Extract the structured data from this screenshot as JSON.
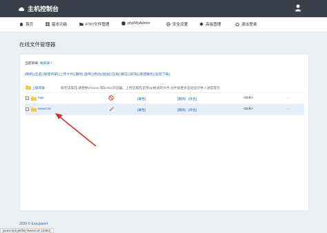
{
  "header": {
    "title": "主机控制台",
    "logo_icon": "cloud-icon",
    "user_icon": "user-icon"
  },
  "nav": [
    {
      "label": "首页",
      "icon": "home-icon"
    },
    {
      "label": "基本功能",
      "icon": "grid-icon"
    },
    {
      "label": "FTP/文件管理",
      "icon": "folder-icon"
    },
    {
      "label": "phpMyAdmin",
      "icon": "database-icon"
    },
    {
      "label": "安全设置",
      "icon": "gear-icon"
    },
    {
      "label": "高级管理",
      "icon": "diamond-icon"
    },
    {
      "label": "退出登录",
      "icon": "power-icon"
    }
  ],
  "page_title": "在线文件管理器",
  "current_dir": {
    "label": "当前目录:",
    "path": "根目录",
    "sep": "/"
  },
  "toolbar": [
    "[刷新]",
    "[全选]",
    "[新建目录]",
    "[上传文件]",
    "[删除]",
    "[复制]",
    "[移动]",
    "[粘贴]",
    "[压缩]",
    "[解压]",
    "[权限]",
    "[重建属性]",
    "[远程下载]"
  ],
  "parent_row": {
    "label": "上级目录",
    "tip": "如无法操作,请更换chrome,或firefox浏览器。上传压缩包支持zip格式的文件,文件能更多自动显示导入进度提示"
  },
  "files": [
    {
      "name": "logs",
      "prop": "[属性]",
      "delete": "[删除]",
      "rename": "[改名]",
      "type": "<DIR>",
      "size": "-",
      "status_icon": "forbidden-icon"
    },
    {
      "name": "wwwroot",
      "prop": "[属性]",
      "delete": "[删除]",
      "rename": "[改名]",
      "type": "<DIR>",
      "size": "-",
      "status_icon": "edit-pen-icon"
    }
  ],
  "footer": {
    "copyright": "2020 ©",
    "brand": "Easypanel"
  },
  "status_bar": "javascript:getfile('/wwwroot',16384)",
  "colors": {
    "topbar": "#3a3f4b",
    "link": "#2a6ebb",
    "highlight_row": "#e6eef9",
    "arrow": "#d32f2f",
    "folder": "#f2c94c"
  }
}
